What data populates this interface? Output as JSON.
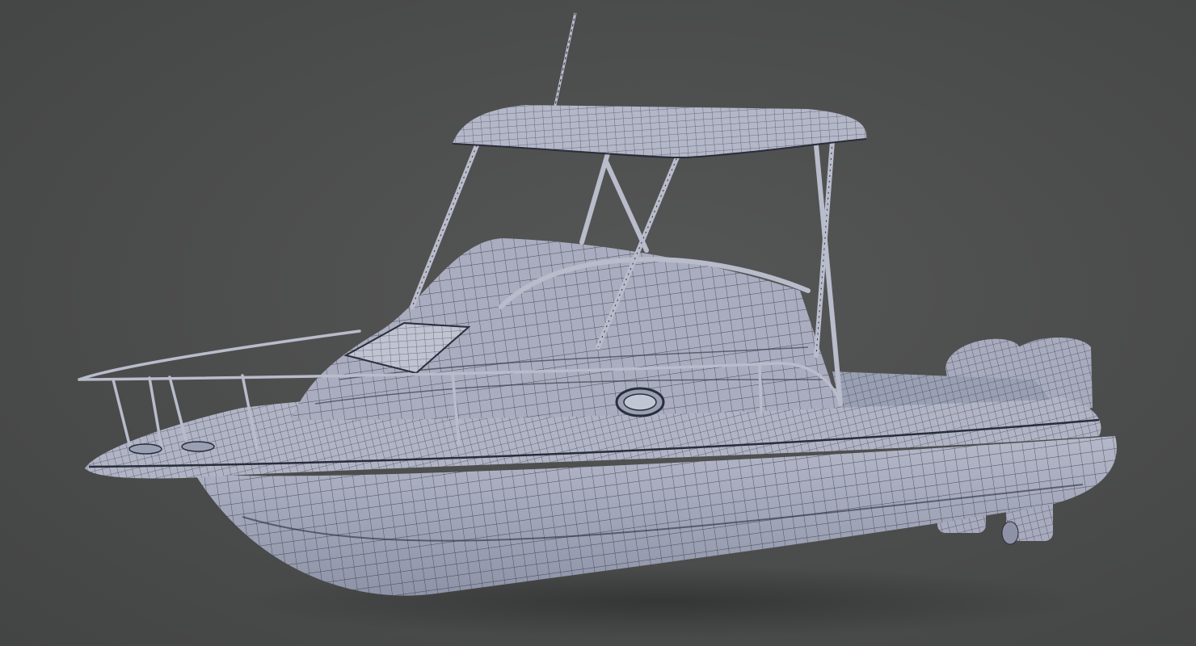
{
  "scene": {
    "subject": "boat-wireframe-render",
    "colors": {
      "background": "#4a4b4b",
      "hull_fill": "#a7abbd",
      "hull_dark": "#8d92a6",
      "wire": "#2a2d3a",
      "rail": "#b8bccb",
      "shadow": "#343535"
    },
    "icons": [
      "boat-model",
      "antenna",
      "hardtop",
      "bow-rail",
      "hatch",
      "porthole",
      "outboard-motor"
    ]
  }
}
